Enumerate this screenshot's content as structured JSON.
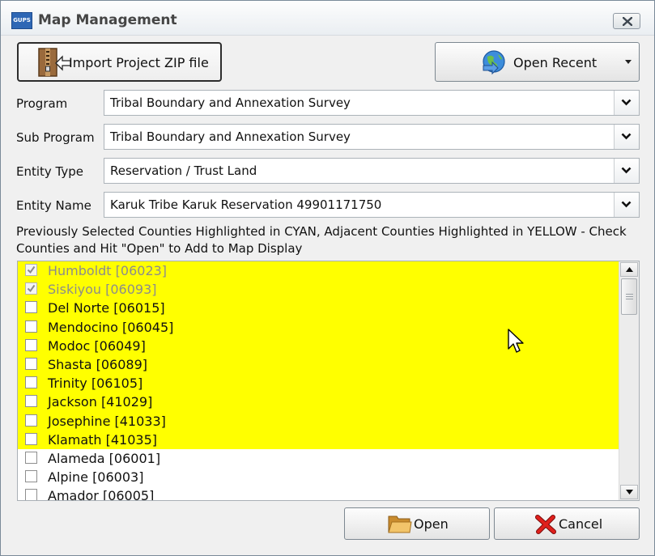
{
  "window": {
    "title": "Map Management",
    "app_icon_text": "GUPS"
  },
  "toolbar": {
    "import_label": "Import Project ZIP file",
    "recent_label": "Open Recent"
  },
  "fields": [
    {
      "label": "Program",
      "value": "Tribal Boundary and Annexation Survey"
    },
    {
      "label": "Sub Program",
      "value": "Tribal Boundary and Annexation Survey"
    },
    {
      "label": "Entity Type",
      "value": "Reservation / Trust Land"
    },
    {
      "label": "Entity Name",
      "value": "Karuk Tribe Karuk Reservation 49901171750"
    }
  ],
  "instructions": "Previously Selected Counties Highlighted in CYAN, Adjacent Counties Highlighted in YELLOW - Check Counties and Hit \"Open\" to Add to Map Display",
  "counties": [
    {
      "name": "Humboldt [06023]",
      "checked": true,
      "disabled": true,
      "highlight": "yellow"
    },
    {
      "name": "Siskiyou [06093]",
      "checked": true,
      "disabled": true,
      "highlight": "yellow"
    },
    {
      "name": "Del Norte [06015]",
      "checked": false,
      "disabled": false,
      "highlight": "yellow"
    },
    {
      "name": "Mendocino [06045]",
      "checked": false,
      "disabled": false,
      "highlight": "yellow"
    },
    {
      "name": "Modoc [06049]",
      "checked": false,
      "disabled": false,
      "highlight": "yellow"
    },
    {
      "name": "Shasta [06089]",
      "checked": false,
      "disabled": false,
      "highlight": "yellow"
    },
    {
      "name": "Trinity [06105]",
      "checked": false,
      "disabled": false,
      "highlight": "yellow"
    },
    {
      "name": "Jackson [41029]",
      "checked": false,
      "disabled": false,
      "highlight": "yellow"
    },
    {
      "name": "Josephine [41033]",
      "checked": false,
      "disabled": false,
      "highlight": "yellow"
    },
    {
      "name": "Klamath [41035]",
      "checked": false,
      "disabled": false,
      "highlight": "yellow"
    },
    {
      "name": "Alameda [06001]",
      "checked": false,
      "disabled": false,
      "highlight": "none"
    },
    {
      "name": "Alpine [06003]",
      "checked": false,
      "disabled": false,
      "highlight": "none"
    },
    {
      "name": "Amador [06005]",
      "checked": false,
      "disabled": false,
      "highlight": "none"
    }
  ],
  "actions": {
    "open_label": "Open",
    "cancel_label": "Cancel"
  },
  "colors": {
    "highlight_yellow": "#ffff00",
    "window_bg": "#f0f0f0",
    "title_text": "#454545"
  },
  "icons": {
    "app": "gups-app-icon",
    "close": "close-icon",
    "import": "zip-import-icon",
    "recent": "globe-recent-icon",
    "dropdown": "chevron-down-icon",
    "open": "folder-icon",
    "cancel": "red-x-icon",
    "cursor": "mouse-pointer-icon"
  }
}
